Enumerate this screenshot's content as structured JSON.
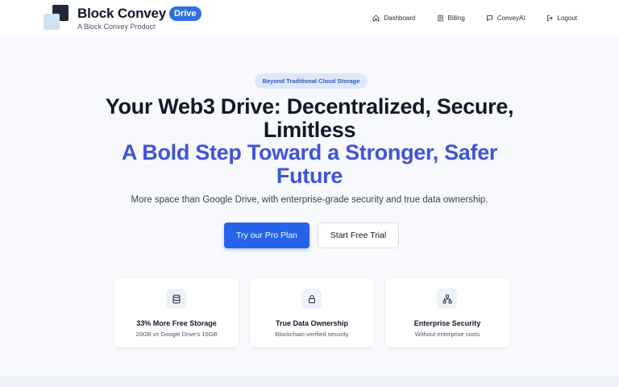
{
  "header": {
    "brand_name": "Block Convey",
    "brand_badge": "Drive",
    "brand_sub": "A Block Convey Product",
    "nav": [
      {
        "label": "Dashboard",
        "icon": "home-icon"
      },
      {
        "label": "Billing",
        "icon": "receipt-icon"
      },
      {
        "label": "ConveyAI",
        "icon": "chat-icon"
      },
      {
        "label": "Logout",
        "icon": "logout-icon"
      }
    ]
  },
  "hero": {
    "pill": "Beyond Traditional Cloud Storage",
    "title_line1": "Your Web3 Drive: Decentralized, Secure,",
    "title_line2": "Limitless",
    "accent_line1": "A Bold Step Toward a Stronger, Safer",
    "accent_line2": "Future",
    "subtitle": "More space than Google Drive, with enterprise-grade security and true data ownership.",
    "primary_button": "Try our Pro Plan",
    "secondary_button": "Start Free Trial"
  },
  "features": [
    {
      "icon": "database-icon",
      "title": "33% More Free Storage",
      "desc": "20GB vs Google Drive's 15GB"
    },
    {
      "icon": "lock-icon",
      "title": "True Data Ownership",
      "desc": "Blockchain-verified security"
    },
    {
      "icon": "network-icon",
      "title": "Enterprise Security",
      "desc": "Without enterprise costs"
    }
  ],
  "colors": {
    "accent": "#2563eb",
    "heading_accent": "#4154d6",
    "badge": "#2f6fe4",
    "pill_bg": "#dde8fb"
  }
}
